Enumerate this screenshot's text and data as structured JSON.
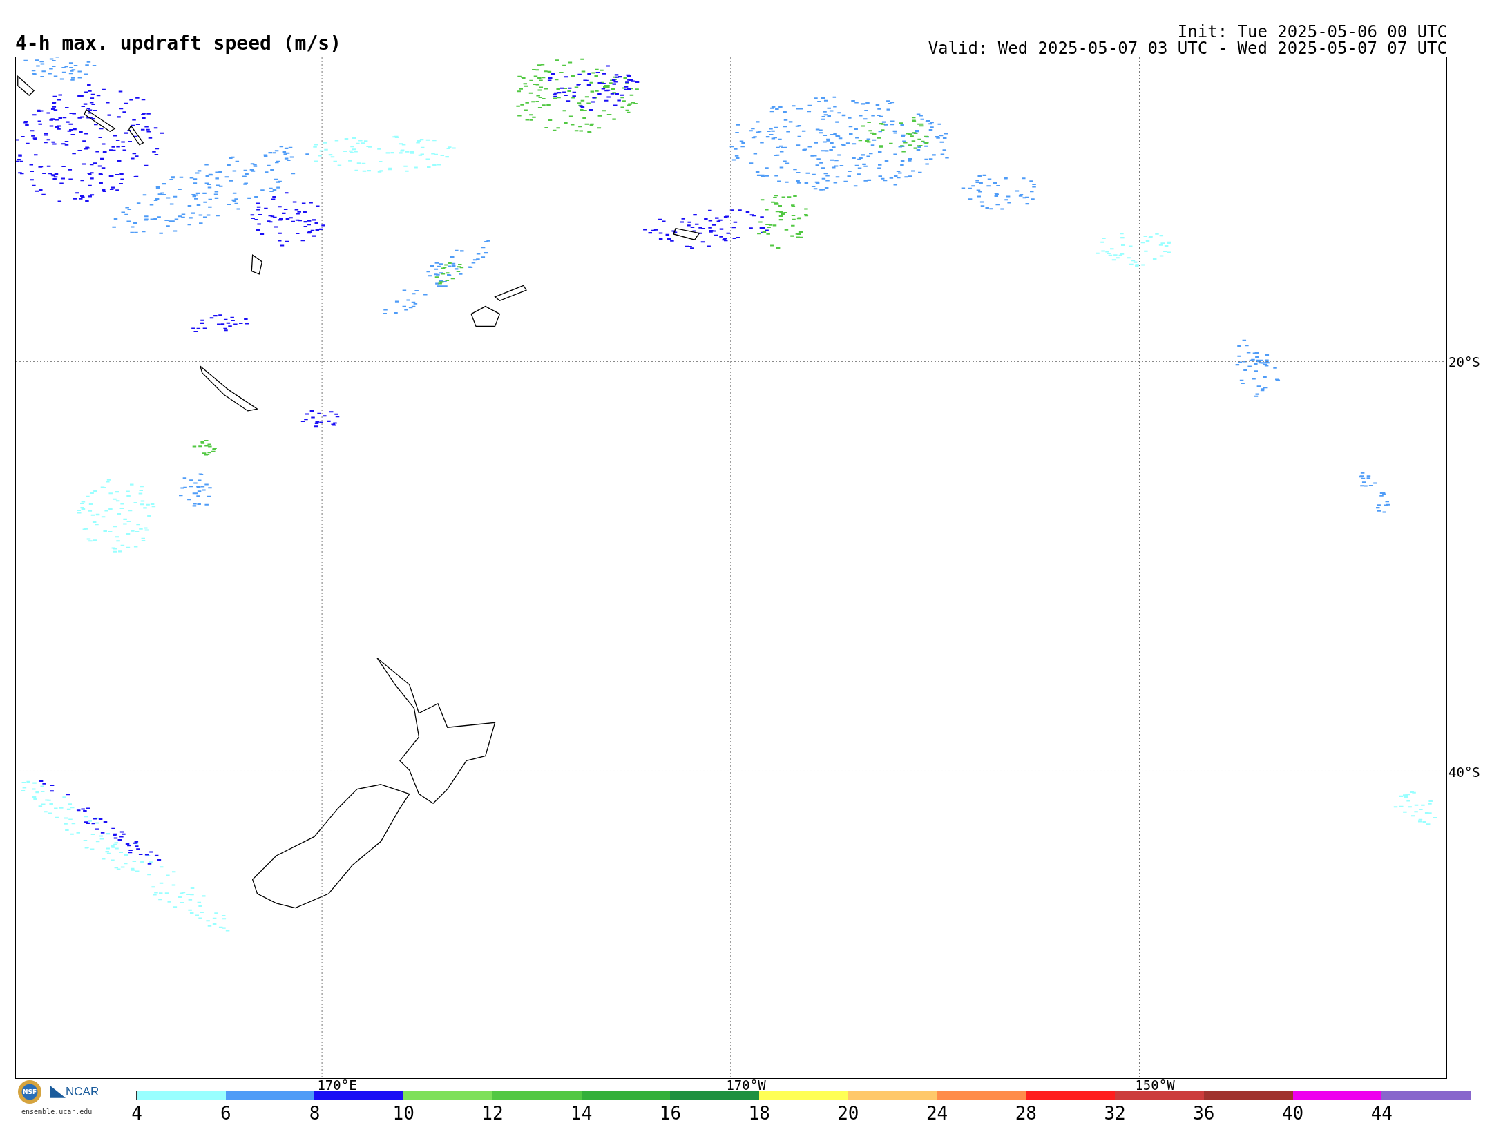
{
  "title": "4-h max. updraft speed (m/s)",
  "init": "Init: Tue 2025-05-06 00 UTC",
  "valid": "Valid: Wed 2025-05-07 03 UTC - Wed 2025-05-07 07 UTC",
  "map": {
    "lat_labels": [
      "20°S",
      "40°S"
    ],
    "lon_labels": [
      "170°E",
      "170°W",
      "150°W"
    ]
  },
  "logos": {
    "seal": "NSF",
    "wordmark": "NCAR",
    "url": "ensemble.ucar.edu"
  },
  "colorbar": {
    "bins": [
      {
        "label": "4",
        "color": "#99ffff"
      },
      {
        "label": "6",
        "color": "#4f9cf7"
      },
      {
        "label": "8",
        "color": "#1a0ff5"
      },
      {
        "label": "10",
        "color": "#7ee05a"
      },
      {
        "label": "12",
        "color": "#52c843"
      },
      {
        "label": "14",
        "color": "#33b03a"
      },
      {
        "label": "16",
        "color": "#1e9140"
      },
      {
        "label": "18",
        "color": "#ffff55"
      },
      {
        "label": "20",
        "color": "#ffc86a"
      },
      {
        "label": "24",
        "color": "#ff8c4a"
      },
      {
        "label": "28",
        "color": "#ff1e1e"
      },
      {
        "label": "32",
        "color": "#cc3c3c"
      },
      {
        "label": "36",
        "color": "#a0322e"
      },
      {
        "label": "40",
        "color": "#ee00ee"
      },
      {
        "label": "44",
        "color": "#8866cc"
      }
    ]
  }
}
